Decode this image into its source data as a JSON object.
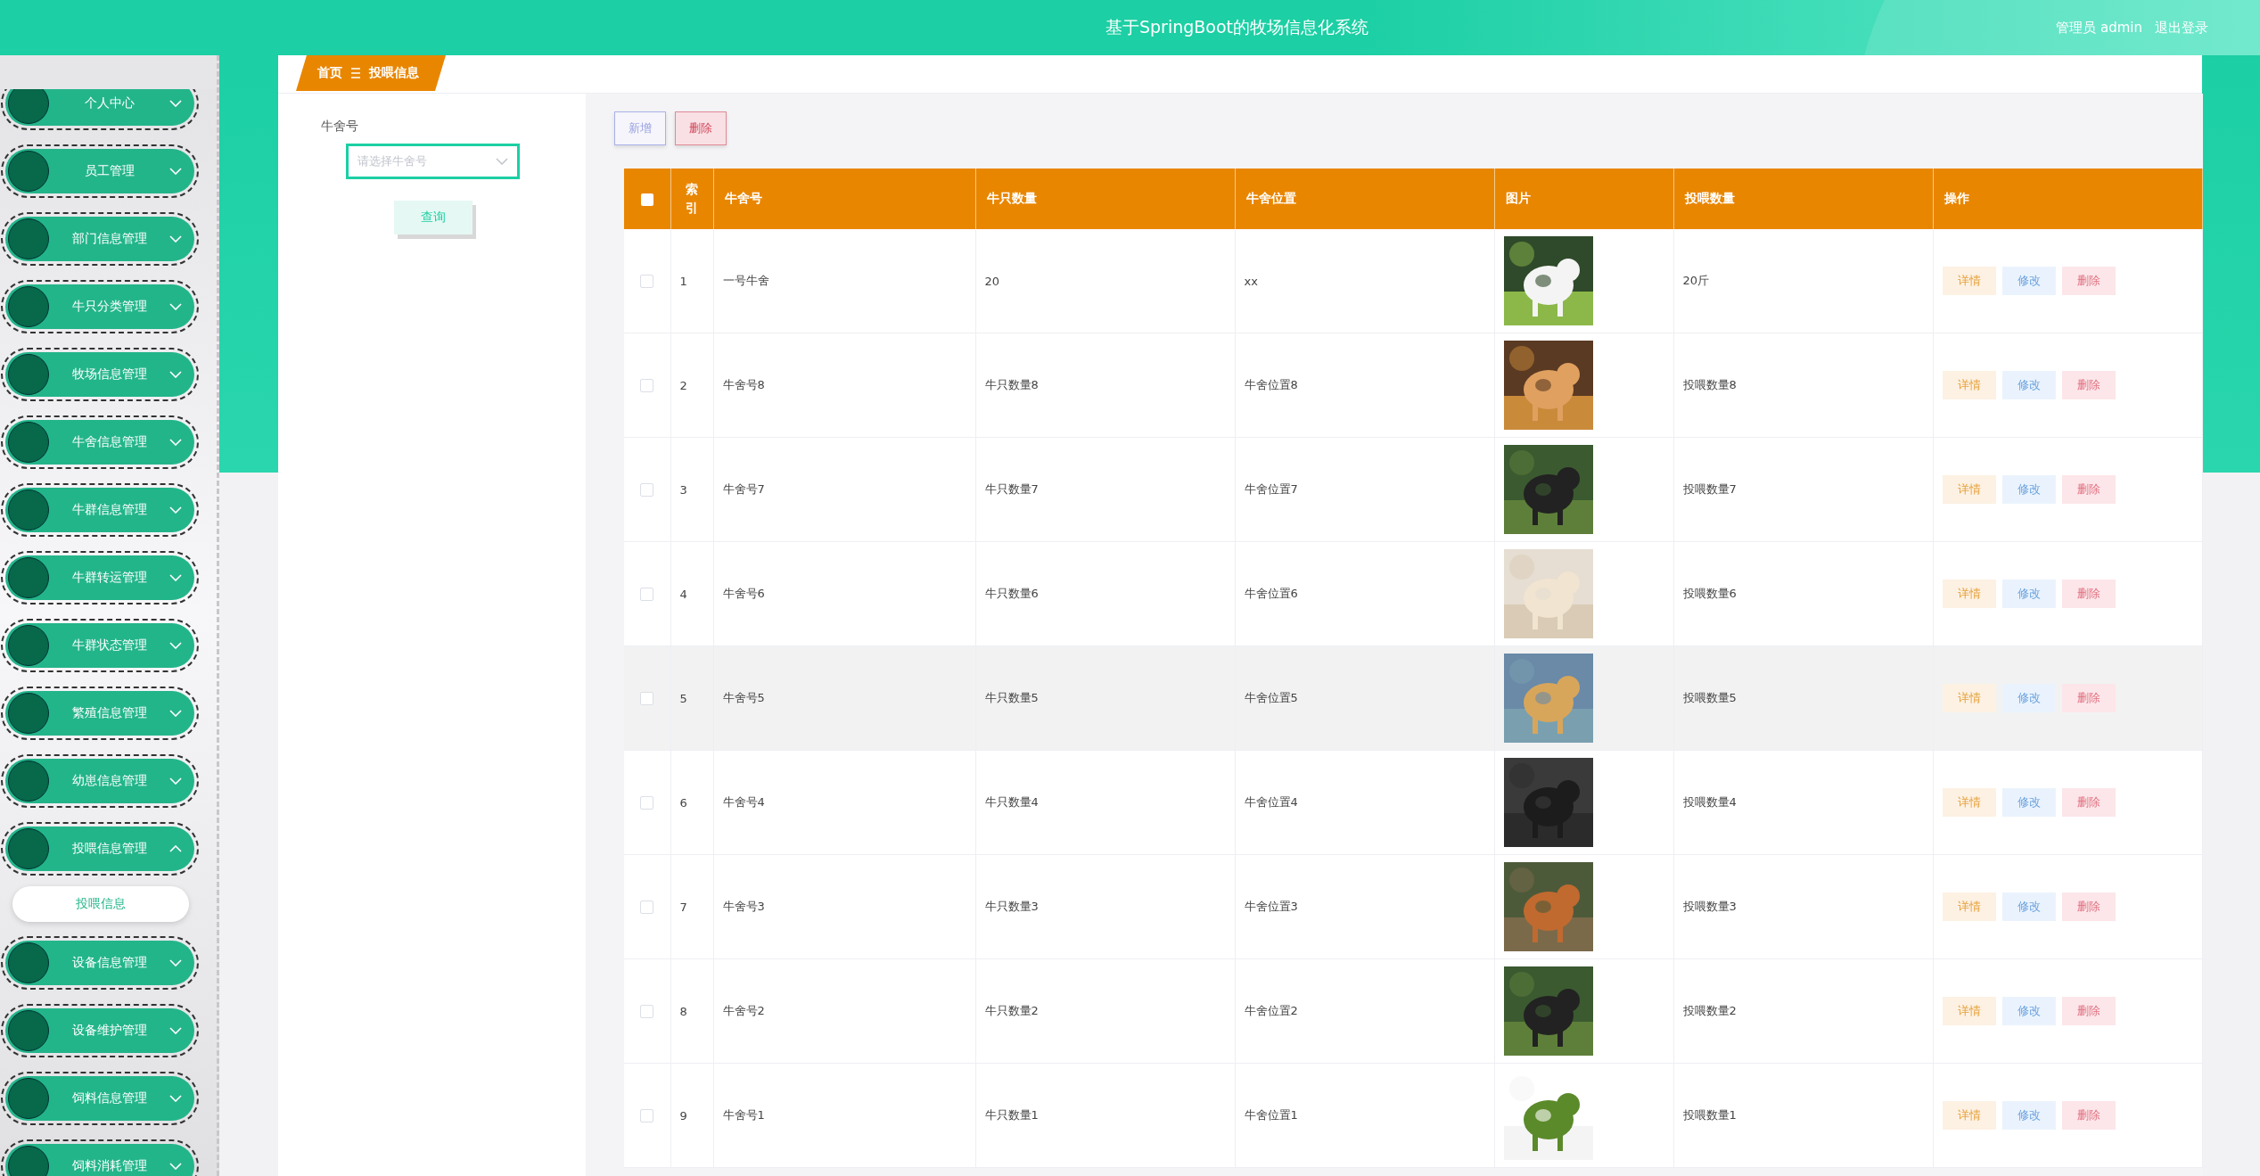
{
  "header": {
    "title": "基于SpringBoot的牧场信息化系统",
    "user": "管理员 admin",
    "logout": "退出登录"
  },
  "sidebar": {
    "items": [
      {
        "label": "个人中心",
        "expanded": false
      },
      {
        "label": "员工管理",
        "expanded": false
      },
      {
        "label": "部门信息管理",
        "expanded": false
      },
      {
        "label": "牛只分类管理",
        "expanded": false
      },
      {
        "label": "牧场信息管理",
        "expanded": false
      },
      {
        "label": "牛舍信息管理",
        "expanded": false
      },
      {
        "label": "牛群信息管理",
        "expanded": false
      },
      {
        "label": "牛群转运管理",
        "expanded": false
      },
      {
        "label": "牛群状态管理",
        "expanded": false
      },
      {
        "label": "繁殖信息管理",
        "expanded": false
      },
      {
        "label": "幼崽信息管理",
        "expanded": false
      },
      {
        "label": "投喂信息管理",
        "expanded": true,
        "children": [
          {
            "label": "投喂信息"
          }
        ]
      },
      {
        "label": "设备信息管理",
        "expanded": false
      },
      {
        "label": "设备维护管理",
        "expanded": false
      },
      {
        "label": "饲料信息管理",
        "expanded": false
      },
      {
        "label": "饲料消耗管理",
        "expanded": false
      }
    ]
  },
  "breadcrumb": [
    "首页",
    "投喂信息"
  ],
  "filter": {
    "label": "牛舍号",
    "placeholder": "请选择牛舍号",
    "button": "查询"
  },
  "toolbar": [
    {
      "label": "新增",
      "kind": "add"
    },
    {
      "label": "删除",
      "kind": "delete"
    }
  ],
  "table": {
    "select_all": {
      "checked": false
    },
    "columns": [
      "索引",
      "牛舍号",
      "牛只数量",
      "牛舍位置",
      "图片",
      "投喂数量",
      "操作"
    ],
    "rows": [
      {
        "checked": false,
        "hover": false,
        "index": "1",
        "shed": "一号牛舍",
        "count": "20",
        "location": "xx",
        "feed": "20斤",
        "actions": [
          {
            "label": "详情",
            "kind": "detail"
          },
          {
            "label": "修改",
            "kind": "edit"
          },
          {
            "label": "删除",
            "kind": "delete"
          }
        ]
      },
      {
        "checked": false,
        "hover": false,
        "index": "2",
        "shed": "牛舍号8",
        "count": "牛只数量8",
        "location": "牛舍位置8",
        "feed": "投喂数量8",
        "actions": [
          {
            "label": "详情",
            "kind": "detail"
          },
          {
            "label": "修改",
            "kind": "edit"
          },
          {
            "label": "删除",
            "kind": "delete"
          }
        ]
      },
      {
        "checked": false,
        "hover": false,
        "index": "3",
        "shed": "牛舍号7",
        "count": "牛只数量7",
        "location": "牛舍位置7",
        "feed": "投喂数量7",
        "actions": [
          {
            "label": "详情",
            "kind": "detail"
          },
          {
            "label": "修改",
            "kind": "edit"
          },
          {
            "label": "删除",
            "kind": "delete"
          }
        ]
      },
      {
        "checked": false,
        "hover": false,
        "index": "4",
        "shed": "牛舍号6",
        "count": "牛只数量6",
        "location": "牛舍位置6",
        "feed": "投喂数量6",
        "actions": [
          {
            "label": "详情",
            "kind": "detail"
          },
          {
            "label": "修改",
            "kind": "edit"
          },
          {
            "label": "删除",
            "kind": "delete"
          }
        ]
      },
      {
        "checked": false,
        "hover": true,
        "index": "5",
        "shed": "牛舍号5",
        "count": "牛只数量5",
        "location": "牛舍位置5",
        "feed": "投喂数量5",
        "actions": [
          {
            "label": "详情",
            "kind": "detail"
          },
          {
            "label": "修改",
            "kind": "edit"
          },
          {
            "label": "删除",
            "kind": "delete"
          }
        ]
      },
      {
        "checked": false,
        "hover": false,
        "index": "6",
        "shed": "牛舍号4",
        "count": "牛只数量4",
        "location": "牛舍位置4",
        "feed": "投喂数量4",
        "actions": [
          {
            "label": "详情",
            "kind": "detail"
          },
          {
            "label": "修改",
            "kind": "edit"
          },
          {
            "label": "删除",
            "kind": "delete"
          }
        ]
      },
      {
        "checked": false,
        "hover": false,
        "index": "7",
        "shed": "牛舍号3",
        "count": "牛只数量3",
        "location": "牛舍位置3",
        "feed": "投喂数量3",
        "actions": [
          {
            "label": "详情",
            "kind": "detail"
          },
          {
            "label": "修改",
            "kind": "edit"
          },
          {
            "label": "删除",
            "kind": "delete"
          }
        ]
      },
      {
        "checked": false,
        "hover": false,
        "index": "8",
        "shed": "牛舍号2",
        "count": "牛只数量2",
        "location": "牛舍位置2",
        "feed": "投喂数量2",
        "actions": [
          {
            "label": "详情",
            "kind": "detail"
          },
          {
            "label": "修改",
            "kind": "edit"
          },
          {
            "label": "删除",
            "kind": "delete"
          }
        ]
      },
      {
        "checked": false,
        "hover": false,
        "index": "9",
        "shed": "牛舍号1",
        "count": "牛只数量1",
        "location": "牛舍位置1",
        "feed": "投喂数量1",
        "actions": [
          {
            "label": "详情",
            "kind": "detail"
          },
          {
            "label": "修改",
            "kind": "edit"
          },
          {
            "label": "删除",
            "kind": "delete"
          }
        ]
      }
    ]
  }
}
